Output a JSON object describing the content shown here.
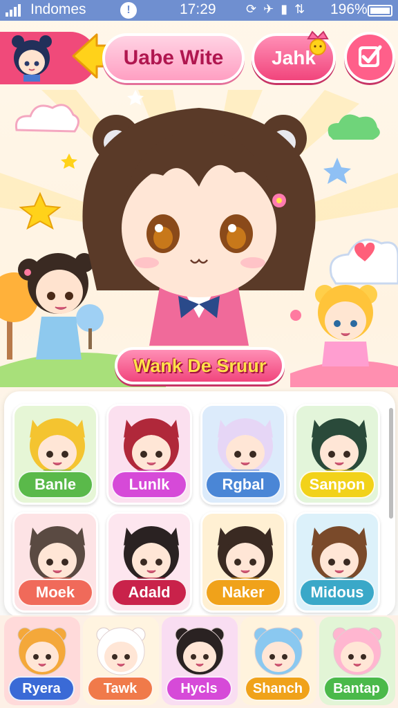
{
  "status_bar": {
    "carrier": "Indomes",
    "notification": "!",
    "time": "17:29",
    "battery": "196%",
    "icons": [
      "sync-icon",
      "airplane-icon",
      "signal-icon",
      "data-icon"
    ]
  },
  "header": {
    "title": "Uabe Wite",
    "action_label": "Jahk"
  },
  "hero": {
    "banner": "Wank De Sruur"
  },
  "grid": [
    {
      "label": "Banle",
      "color": "#5ab94a",
      "bg": "#e6f6d6"
    },
    {
      "label": "Lunlk",
      "color": "#d64ad8",
      "bg": "#fbe0ef"
    },
    {
      "label": "Rgbal",
      "color": "#4a86d6",
      "bg": "#dcebfb"
    },
    {
      "label": "Sanpon",
      "color": "#f2d21a",
      "bg": "#e3f5da"
    },
    {
      "label": "Moek",
      "color": "#f06a5a",
      "bg": "#fde3e5"
    },
    {
      "label": "Adald",
      "color": "#c9224a",
      "bg": "#fde6ef"
    },
    {
      "label": "Naker",
      "color": "#f0a21a",
      "bg": "#fff0d3"
    },
    {
      "label": "Midous",
      "color": "#3aa8c8",
      "bg": "#dcf1fa"
    }
  ],
  "bottom": [
    {
      "label": "Ryera",
      "color": "#3a6ad6",
      "bg": "#ffdada"
    },
    {
      "label": "Tawk",
      "color": "#f07a4a",
      "bg": "#fff4e0"
    },
    {
      "label": "Hycls",
      "color": "#d64ad8",
      "bg": "#f9ddf2"
    },
    {
      "label": "Shanch",
      "color": "#f0a21a",
      "bg": "#fff3dd"
    },
    {
      "label": "Bantap",
      "color": "#4ab94a",
      "bg": "#e2f5d6"
    }
  ]
}
